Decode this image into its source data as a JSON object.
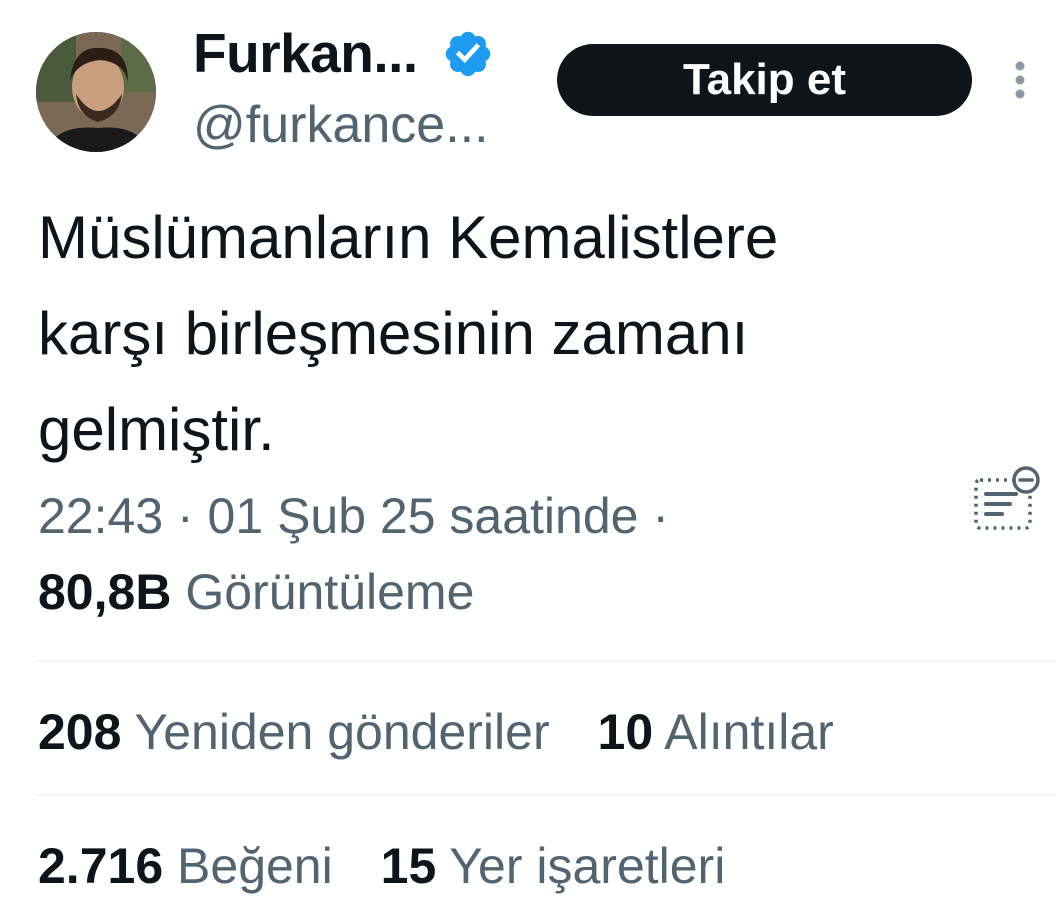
{
  "author": {
    "display_name": "Furkan...",
    "handle": "@furkance...",
    "verified_icon": "verified-badge-icon",
    "avatar": "profile-photo"
  },
  "actions": {
    "follow_label": "Takip et",
    "more_icon": "more-vertical-icon",
    "notes_icon": "community-notes-icon"
  },
  "tweet": {
    "lines": [
      "Müslümanların Kemalistlere",
      "karşı birleşmesinin zamanı",
      "gelmiştir."
    ],
    "meta": "22:43 · 01 Şub 25 saatinde ·",
    "views_count": "80,8B",
    "views_label": "Görüntüleme"
  },
  "stats": {
    "retweets_count": "208",
    "retweets_label": "Yeniden gönderiler",
    "quotes_count": "10",
    "quotes_label": "Alıntılar",
    "likes_count": "2.716",
    "likes_label": "Beğeni",
    "bookmarks_count": "15",
    "bookmarks_label": "Yer işaretleri"
  },
  "colors": {
    "text_primary": "#0f1419",
    "text_secondary": "#536471",
    "verified_blue": "#1d9bf0",
    "divider": "#eff3f4",
    "button_bg": "#0f1419"
  }
}
